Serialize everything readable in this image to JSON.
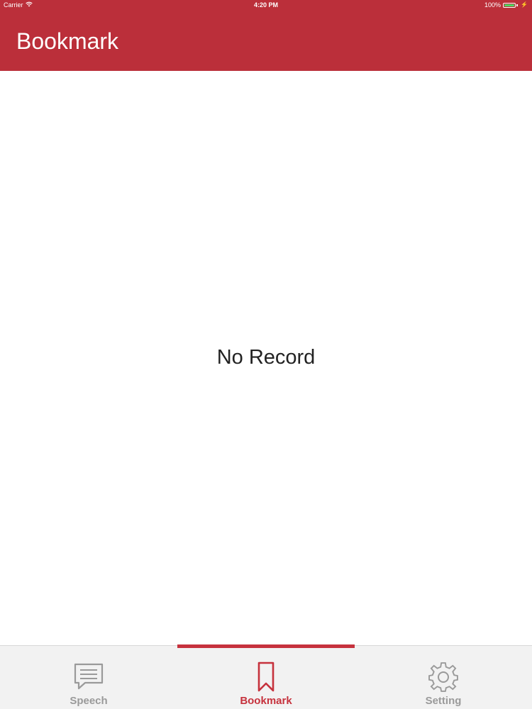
{
  "status_bar": {
    "carrier": "Carrier",
    "time": "4:20 PM",
    "battery": "100%",
    "battery_level": 1.0,
    "icons": [
      "wifi-icon",
      "battery-icon",
      "charging-bolt-icon"
    ]
  },
  "nav_bar": {
    "title": "Bookmark"
  },
  "content": {
    "empty_message": "No Record"
  },
  "tab_bar": {
    "active_tab": 1,
    "tabs": [
      {
        "label": "Speech",
        "icon": "speech-bubble-icon"
      },
      {
        "label": "Bookmark",
        "icon": "bookmark-icon"
      },
      {
        "label": "Setting",
        "icon": "gear-icon"
      }
    ]
  },
  "colors": {
    "brand_red": "#bb2f3a",
    "active_tab": "#c6323d",
    "inactive_tab": "#9a9a9a",
    "tab_bar_bg": "#f2f2f2",
    "battery_green": "#4cd964"
  }
}
